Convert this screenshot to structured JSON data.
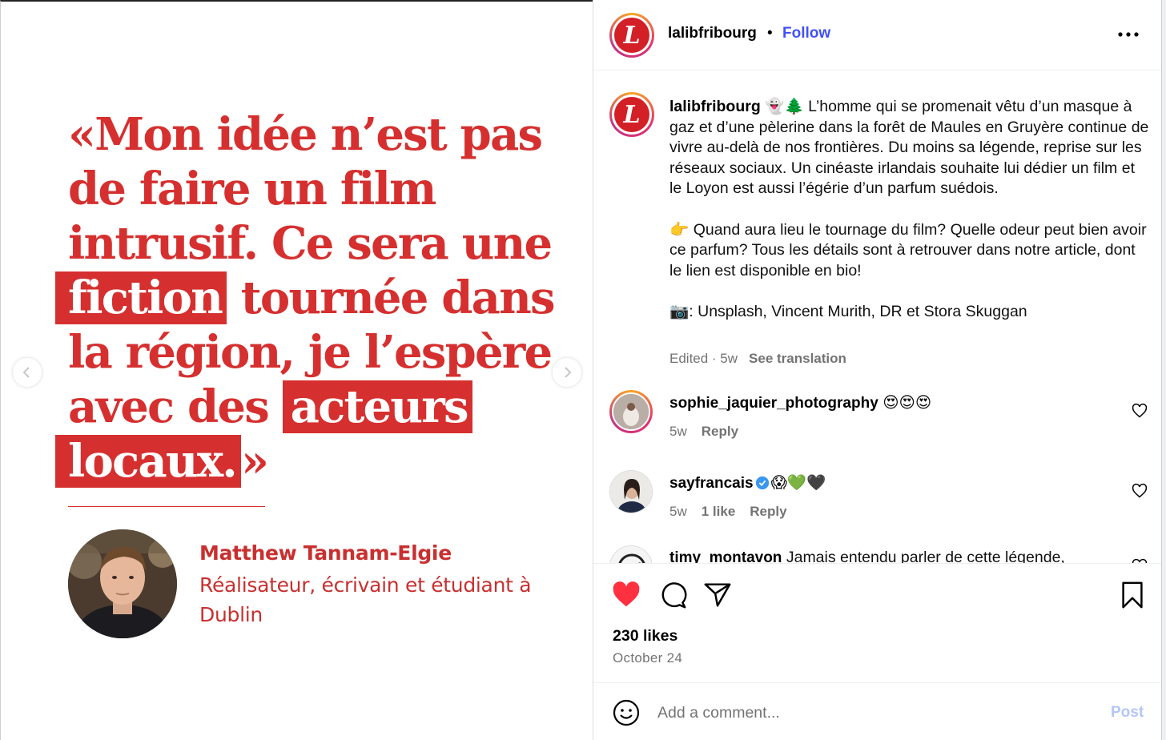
{
  "slide": {
    "quote_lines": [
      {
        "before": "«Mon idée n’est pas",
        "highlight": "",
        "after": ""
      },
      {
        "before": "de faire un film",
        "highlight": "",
        "after": ""
      },
      {
        "before": "intrusif. Ce sera une",
        "highlight": "",
        "after": ""
      },
      {
        "before": "",
        "highlight": "fiction",
        "after": " tournée dans"
      },
      {
        "before": "la région, je l’espère",
        "highlight": "",
        "after": ""
      },
      {
        "before": "avec des ",
        "highlight": "acteurs",
        "after": ""
      },
      {
        "before": "",
        "highlight": "locaux.",
        "after": "»"
      }
    ],
    "author_name": "Matthew Tannam-Elgie",
    "author_role": "Réalisateur, écrivain et étudiant à Dublin",
    "accent_color": "#d5302f"
  },
  "header": {
    "logo_letter": "L",
    "username": "lalibfribourg",
    "separator": "•",
    "follow_label": "Follow"
  },
  "caption": {
    "username": "lalibfribourg",
    "emojis": "👻🌲",
    "paragraph1": "L’homme qui se promenait vêtu d’un masque à gaz et d’une pèlerine dans la forêt de Maules en Gruyère continue de vivre au-delà de nos frontières. Du moins sa légende, reprise sur les réseaux sociaux. Un cinéaste irlandais souhaite lui dédier un film et le Loyon est aussi l’égérie d’un parfum suédois.",
    "paragraph2": "👉 Quand aura lieu le tournage du film? Quelle odeur peut bien avoir ce parfum? Tous les détails sont à retrouver dans notre article, dont le lien est disponible en bio!",
    "paragraph3": "📷: Unsplash, Vincent Murith, DR et Stora Skuggan",
    "edited": "Edited · 5w",
    "see_translation": "See translation"
  },
  "comments": [
    {
      "username": "sophie_jaquier_photography",
      "text": "😍😍😍",
      "age": "5w",
      "likes": "",
      "reply": "Reply"
    },
    {
      "username": "sayfrancais",
      "text": "😱💚🖤",
      "age": "5w",
      "likes": "1 like",
      "reply": "Reply"
    },
    {
      "username": "timy_montavon",
      "text": "Jamais entendu parler de cette légende,",
      "age": "",
      "likes": "",
      "reply": ""
    }
  ],
  "actions": {
    "likes_text": "230 likes",
    "date": "October 24",
    "liked": true
  },
  "add_comment": {
    "placeholder": "Add a comment...",
    "post_label": "Post"
  },
  "colors": {
    "follow_blue": "#4150f7",
    "like_red": "#ff3040",
    "post_disabled": "#b3c6f7"
  }
}
